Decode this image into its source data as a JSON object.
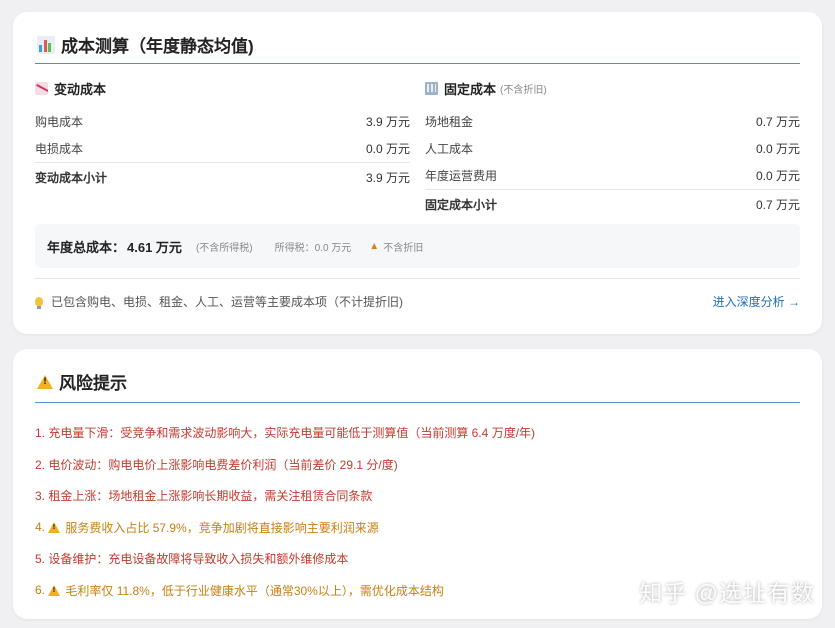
{
  "cost_card": {
    "title": "成本测算（年度静态均值)",
    "variable": {
      "heading": "变动成本",
      "rows": [
        {
          "label": "购电成本",
          "value": "3.9 万元"
        },
        {
          "label": "电损成本",
          "value": "0.0 万元"
        }
      ],
      "subtotal": {
        "label": "变动成本小计",
        "value": "3.9 万元"
      }
    },
    "fixed": {
      "heading": "固定成本",
      "note": "(不含折旧)",
      "rows": [
        {
          "label": "场地租金",
          "value": "0.7 万元"
        },
        {
          "label": "人工成本",
          "value": "0.0 万元"
        },
        {
          "label": "年度运营费用",
          "value": "0.0 万元"
        }
      ],
      "subtotal": {
        "label": "固定成本小计",
        "value": "0.7 万元"
      }
    },
    "summary": {
      "total_label": "年度总成本：",
      "total_value": "4.61 万元",
      "excl_tax": "(不含所得税)",
      "tax": "所得税：0.0 万元",
      "no_dep": "不含折旧"
    },
    "footer_hint": "已包含购电、电损、租金、人工、运营等主要成本项（不计提折旧)",
    "footer_link": "进入深度分析 →"
  },
  "risk_card": {
    "title": "风险提示",
    "items": [
      {
        "text": "1. 充电量下滑：受竞争和需求波动影响大，实际充电量可能低于测算值（当前测算 6.4 万度/年)",
        "level": "red",
        "warn": false
      },
      {
        "text": "2. 电价波动：购电电价上涨影响电费差价利润（当前差价 29.1 分/度)",
        "level": "red",
        "warn": false
      },
      {
        "text": "3. 租金上涨：场地租金上涨影响长期收益，需关注租赁合同条款",
        "level": "red",
        "warn": false
      },
      {
        "prefix": "4.",
        "text": "服务费收入占比 57.9%，竞争加剧将直接影响主要利润来源",
        "level": "orange",
        "warn": true
      },
      {
        "text": "5. 设备维护：充电设备故障将导致收入损失和额外维修成本",
        "level": "red",
        "warn": false
      },
      {
        "prefix": "6.",
        "text": "毛利率仅 11.8%，低于行业健康水平（通常30%以上），需优化成本结构",
        "level": "orange",
        "warn": true
      }
    ]
  },
  "watermark": "知乎 @选址有数",
  "colors": {
    "accent_line": "#5b8fbf",
    "risk_red": "#c43a2e",
    "risk_orange": "#c77f12",
    "link": "#1e6fb8"
  }
}
